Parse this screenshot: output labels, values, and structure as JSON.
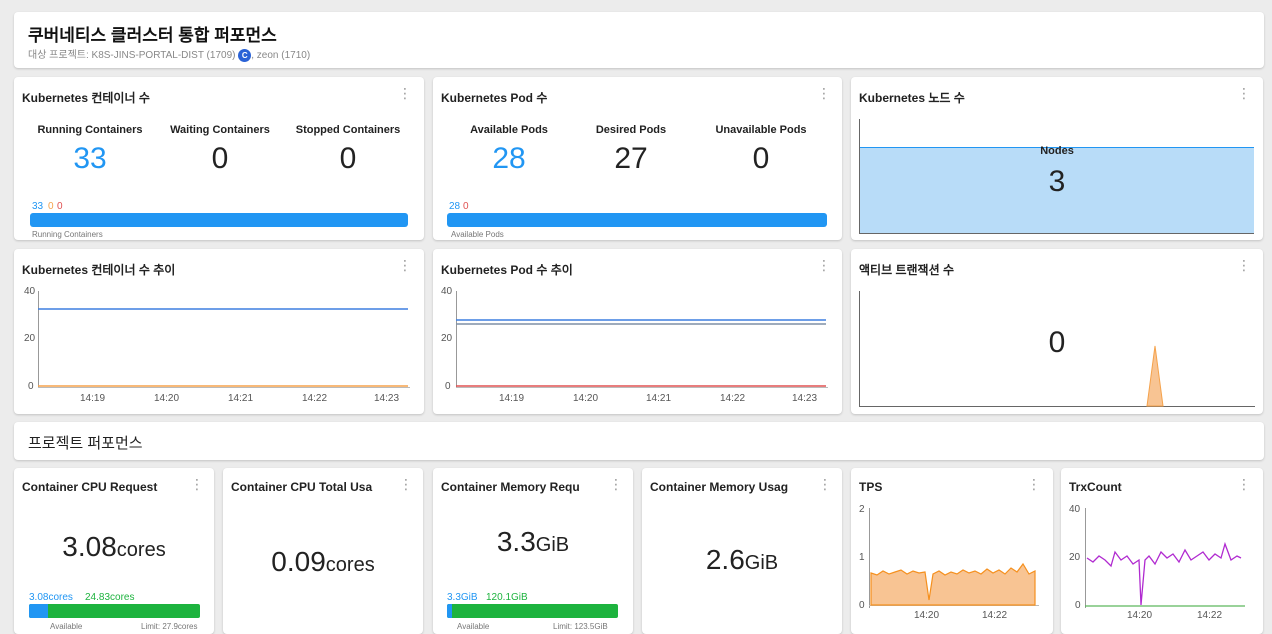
{
  "header": {
    "title": "쿠버네티스 클러스터 통합 퍼포먼스",
    "subtitle_prefix": "대상 프로젝트: K8S-JINS-PORTAL-DIST (1709)",
    "badge": "C",
    "subtitle_suffix": ", zeon (1710)"
  },
  "containers": {
    "title": "Kubernetes 컨테이너 수",
    "stats": [
      {
        "label": "Running Containers",
        "value": "33"
      },
      {
        "label": "Waiting Containers",
        "value": "0"
      },
      {
        "label": "Stopped Containers",
        "value": "0"
      }
    ],
    "bar_nums": [
      "33",
      "0",
      "0"
    ],
    "bar_caption": "Running Containers"
  },
  "pods": {
    "title": "Kubernetes Pod 수",
    "stats": [
      {
        "label": "Available Pods",
        "value": "28"
      },
      {
        "label": "Desired Pods",
        "value": "27"
      },
      {
        "label": "Unavailable Pods",
        "value": "0"
      }
    ],
    "bar_nums": [
      "28",
      "0"
    ],
    "bar_caption": "Available Pods"
  },
  "nodes": {
    "title": "Kubernetes 노드 수",
    "label": "Nodes",
    "value": "3"
  },
  "container_trend": {
    "title": "Kubernetes 컨테이너 수 추이",
    "yticks": [
      "40",
      "20",
      "0"
    ],
    "xticks": [
      "14:19",
      "14:20",
      "14:21",
      "14:22",
      "14:23"
    ]
  },
  "pod_trend": {
    "title": "Kubernetes Pod 수 추이",
    "yticks": [
      "40",
      "20",
      "0"
    ],
    "xticks": [
      "14:19",
      "14:20",
      "14:21",
      "14:22",
      "14:23"
    ]
  },
  "active_tx": {
    "title": "액티브 트랜잭션 수",
    "value": "0"
  },
  "project_section": {
    "title": "프로젝트 퍼포먼스"
  },
  "cpu_request": {
    "title": "Container CPU Request",
    "value": "3.08",
    "unit": "cores",
    "bar_value": "3.08cores",
    "bar_limit": "24.83cores",
    "caption_left": "Available",
    "caption_right": "Limit: 27.9cores"
  },
  "cpu_usage": {
    "title": "Container CPU Total Usa",
    "value": "0.09",
    "unit": "cores"
  },
  "mem_request": {
    "title": "Container Memory Requ",
    "value": "3.3",
    "unit": "GiB",
    "bar_value": "3.3GiB",
    "bar_limit": "120.1GiB",
    "caption_left": "Available",
    "caption_right": "Limit: 123.5GiB"
  },
  "mem_usage": {
    "title": "Container Memory Usag",
    "value": "2.6",
    "unit": "GiB"
  },
  "tps": {
    "title": "TPS",
    "yticks": [
      "2",
      "1",
      "0"
    ],
    "xticks": [
      "14:20",
      "14:22"
    ]
  },
  "trx": {
    "title": "TrxCount",
    "yticks": [
      "40",
      "20",
      "0"
    ],
    "xticks": [
      "14:20",
      "14:22"
    ]
  },
  "menu_icon_glyph": "⋮",
  "colors": {
    "accent": "#2196f3",
    "green": "#1db33e",
    "orange": "#f5a24b",
    "purple": "#b02ad0",
    "red": "#e05252"
  }
}
